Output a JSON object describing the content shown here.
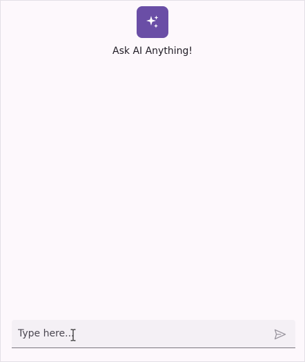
{
  "header": {
    "icon": "sparkles-icon",
    "title": "Ask AI Anything!"
  },
  "composer": {
    "placeholder": "Type here...",
    "value": "",
    "send_icon": "send-icon"
  },
  "colors": {
    "accent": "#6a4ea6",
    "background": "#fdf8fc",
    "input_background": "#f4f0f5"
  }
}
